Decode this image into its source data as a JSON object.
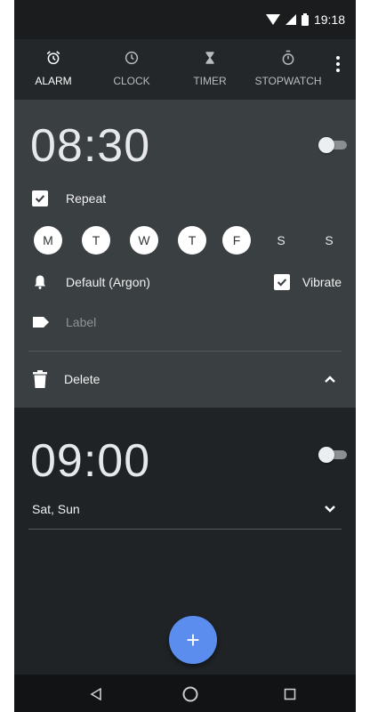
{
  "status_bar": {
    "time": "19:18"
  },
  "tabs": [
    {
      "label": "ALARM",
      "icon": "alarm-icon",
      "active": true
    },
    {
      "label": "CLOCK",
      "icon": "clock-icon",
      "active": false
    },
    {
      "label": "TIMER",
      "icon": "hourglass-icon",
      "active": false
    },
    {
      "label": "STOPWATCH",
      "icon": "stopwatch-icon",
      "active": false
    }
  ],
  "alarms": [
    {
      "time": "08:30",
      "enabled": false,
      "expanded": true,
      "repeat_label": "Repeat",
      "repeat_checked": true,
      "days": [
        {
          "label": "M",
          "selected": true
        },
        {
          "label": "T",
          "selected": true
        },
        {
          "label": "W",
          "selected": true
        },
        {
          "label": "T",
          "selected": true
        },
        {
          "label": "F",
          "selected": true
        },
        {
          "label": "S",
          "selected": false
        },
        {
          "label": "S",
          "selected": false
        }
      ],
      "ringtone": "Default (Argon)",
      "vibrate_label": "Vibrate",
      "vibrate_checked": true,
      "label_placeholder": "Label",
      "delete_label": "Delete"
    },
    {
      "time": "09:00",
      "enabled": false,
      "expanded": false,
      "summary": "Sat, Sun"
    }
  ],
  "fab": {
    "label": "+"
  },
  "colors": {
    "background": "#1f2326",
    "expanded_card": "#3a3f42",
    "fab": "#5b8def",
    "label_placeholder": "#8e9396"
  }
}
